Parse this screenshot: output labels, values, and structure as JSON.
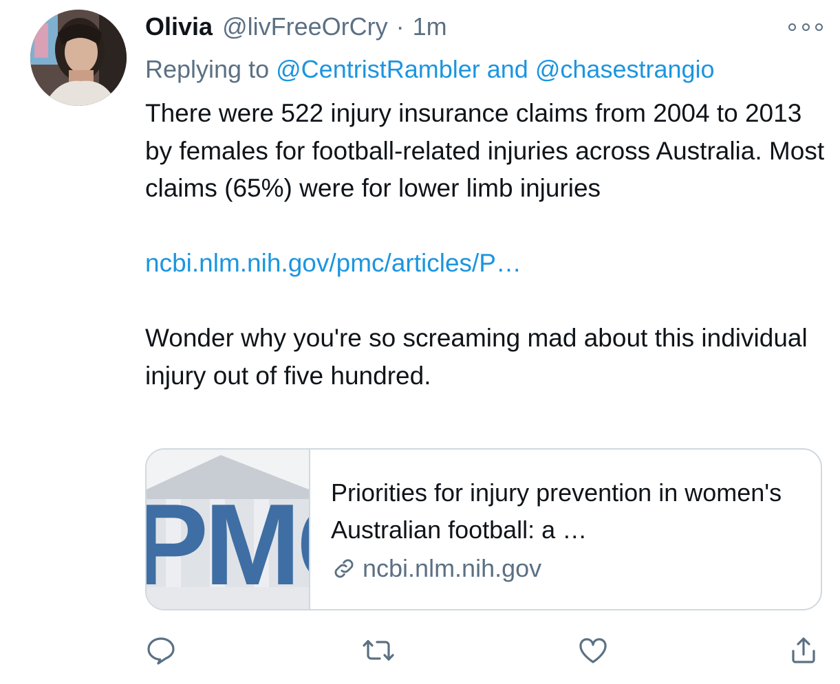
{
  "tweet": {
    "display_name": "Olivia",
    "handle": "@livFreeOrCry",
    "separator": "·",
    "time": "1m",
    "replying_prefix": "Replying to",
    "replying_users": [
      "@CentristRambler",
      "@chasestrangio"
    ],
    "replying_conjunction": "and",
    "paragraph1": "There were 522 injury insurance claims from 2004 to 2013 by females for football-related injuries across Australia. Most claims (65%) were for lower limb injuries",
    "link_text": "ncbi.nlm.nih.gov/pmc/articles/P…",
    "paragraph2": "Wonder why you're so screaming mad about this individual injury out of five hundred."
  },
  "card": {
    "thumbnail_text": "PMC",
    "title": "Priorities for injury prevention in women's Australian football: a …",
    "domain": "ncbi.nlm.nih.gov",
    "icon": "link-icon"
  },
  "actions": [
    {
      "name": "reply",
      "icon": "reply-icon"
    },
    {
      "name": "retweet",
      "icon": "retweet-icon"
    },
    {
      "name": "like",
      "icon": "heart-icon"
    },
    {
      "name": "share",
      "icon": "share-icon"
    }
  ],
  "colors": {
    "link": "#1b95e0",
    "secondary_text": "#5b7083",
    "pmc_blue": "#3e6ea3"
  }
}
